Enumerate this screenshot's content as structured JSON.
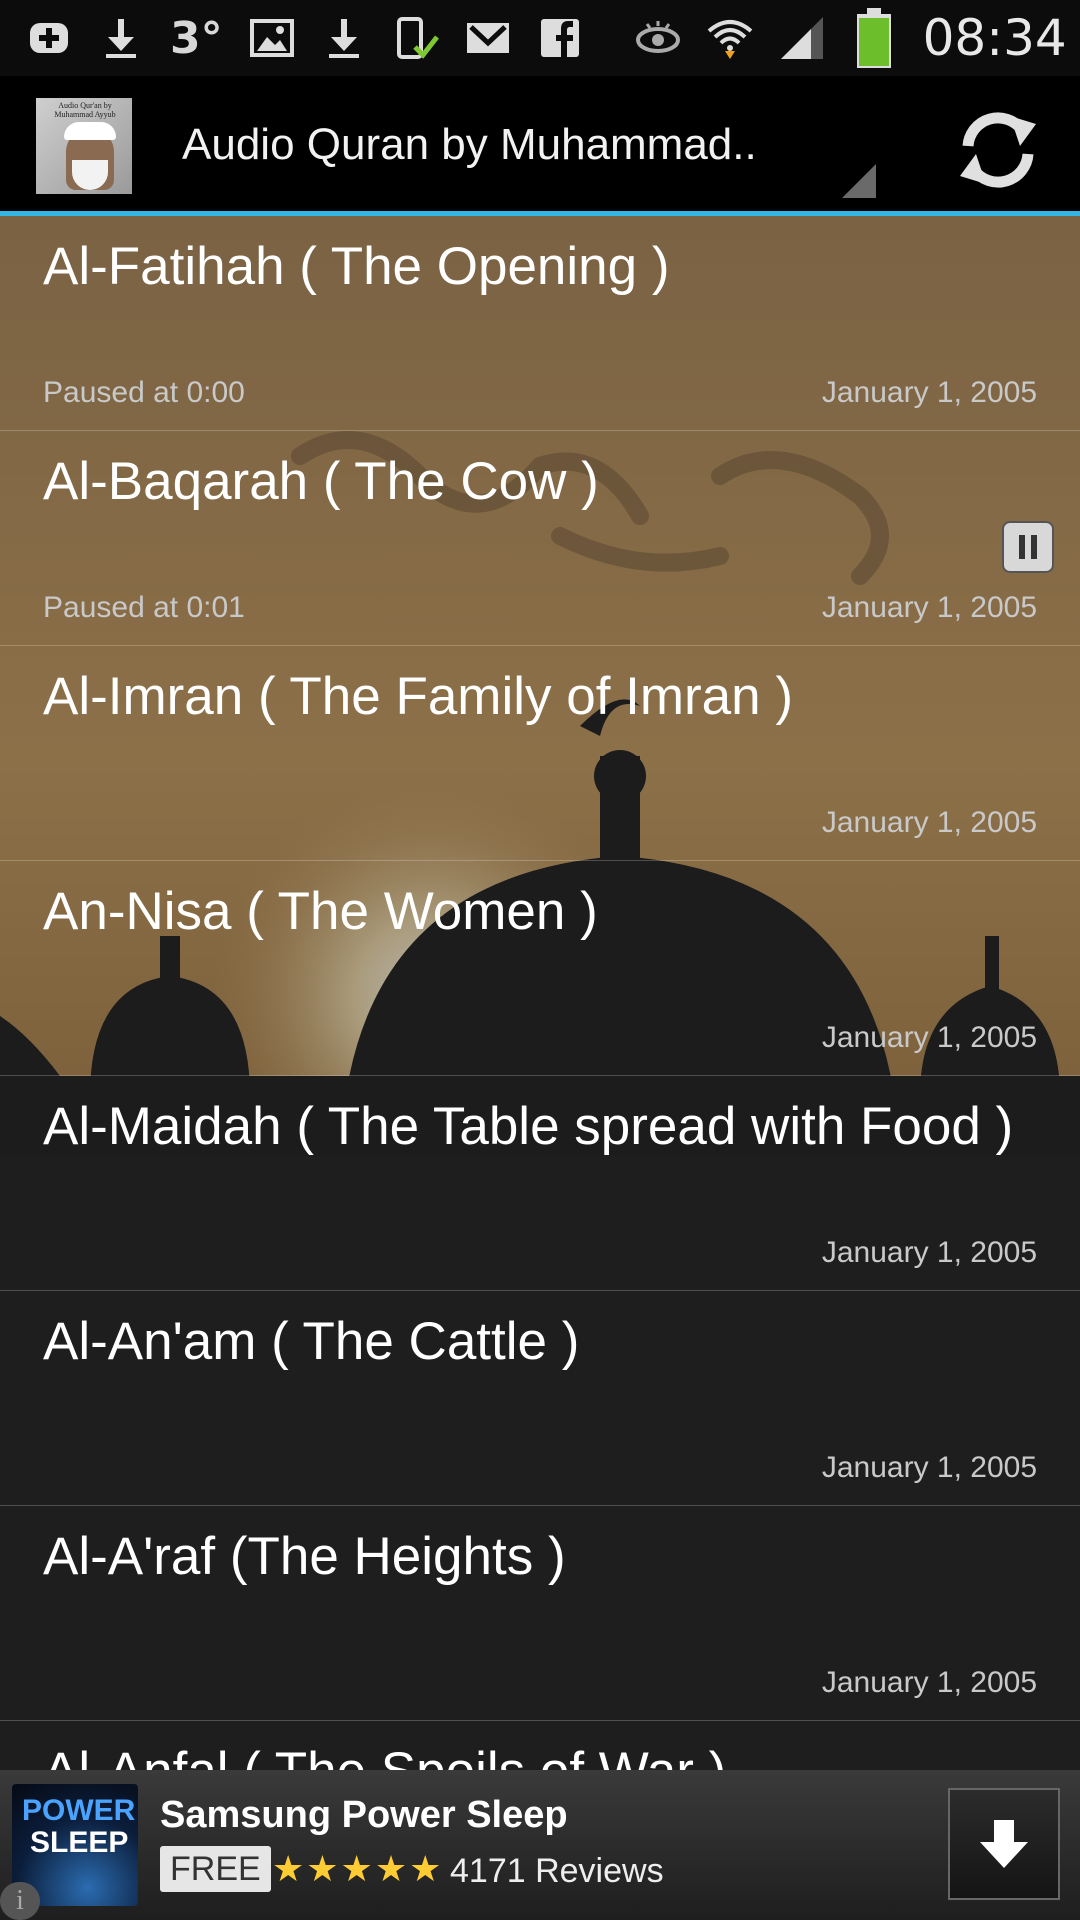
{
  "status_bar": {
    "temperature": "3°",
    "time": "08:34",
    "icons": [
      "plus-icon",
      "download-icon",
      "image-icon",
      "download-icon",
      "phone-check-icon",
      "gmail-icon",
      "facebook-icon",
      "eye-icon",
      "wifi-icon",
      "signal-icon",
      "battery-icon"
    ],
    "battery_color": "#6cbf2a"
  },
  "action_bar": {
    "title": "Audio Quran by Muhammad..",
    "app_icon_caption": "Audio Qur'an by Muhammad Ayyub",
    "accent_color": "#33b5e5"
  },
  "surahs": [
    {
      "title": "Al-Fatihah ( The Opening )",
      "status": "Paused at 0:00",
      "date": "January 1, 2005"
    },
    {
      "title": "Al-Baqarah ( The Cow )",
      "status": "Paused at 0:01",
      "date": "January 1, 2005"
    },
    {
      "title": "Al-Imran ( The Family of Imran )",
      "status": "",
      "date": "January 1, 2005"
    },
    {
      "title": "An-Nisa ( The Women )",
      "status": "",
      "date": "January 1, 2005"
    },
    {
      "title": "Al-Maidah ( The Table spread with Food )",
      "status": "",
      "date": "January 1, 2005"
    },
    {
      "title": "Al-An'am ( The Cattle )",
      "status": "",
      "date": "January 1, 2005"
    },
    {
      "title": "Al-A'raf (The Heights )",
      "status": "",
      "date": "January 1, 2005"
    },
    {
      "title": "Al-Anfal ( The Spoils of War )",
      "status": "",
      "date": ""
    }
  ],
  "ad": {
    "icon_line1": "POWER",
    "icon_line2": "SLEEP",
    "title": "Samsung Power Sleep",
    "price": "FREE",
    "stars": "★★★★★",
    "reviews": "4171 Reviews"
  }
}
